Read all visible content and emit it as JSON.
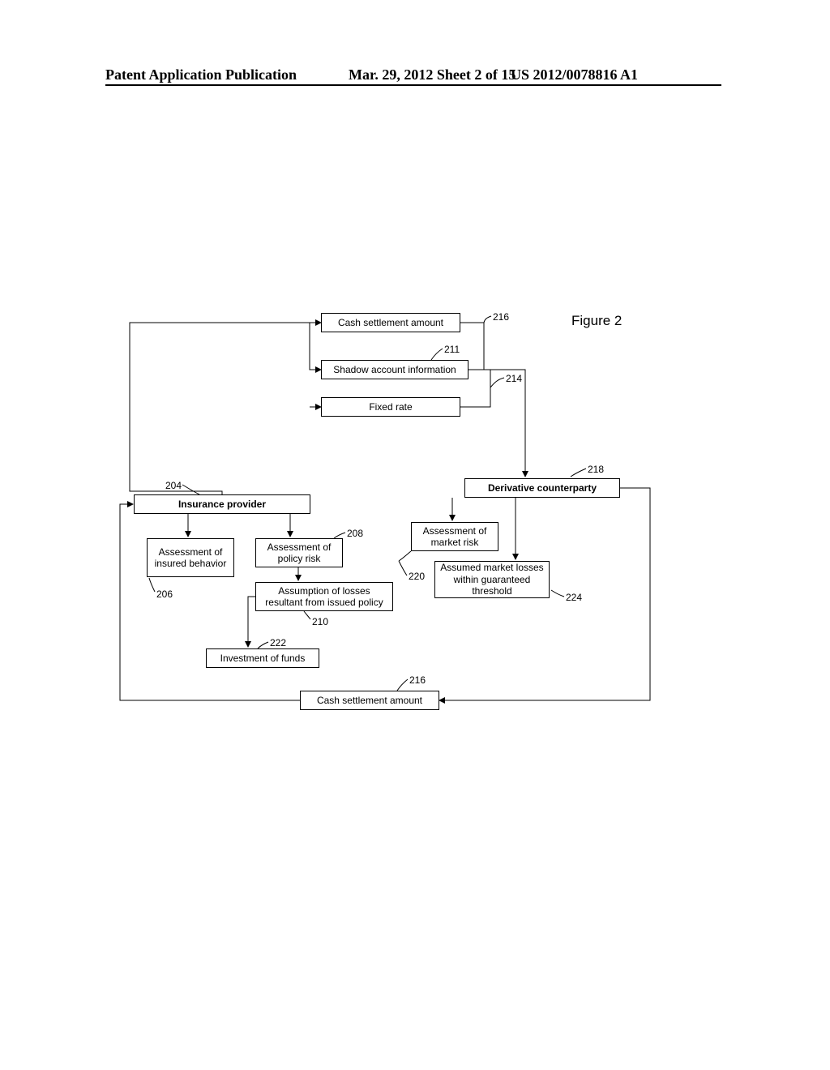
{
  "header": {
    "left": "Patent Application Publication",
    "mid": "Mar. 29, 2012  Sheet 2 of 15",
    "right": "US 2012/0078816 A1"
  },
  "figureLabel": "Figure 2",
  "boxes": {
    "cash_top": "Cash settlement amount",
    "shadow": "Shadow account information",
    "fixed": "Fixed rate",
    "insurance_provider": "Insurance provider",
    "derivative_cp": "Derivative counterparty",
    "assess_behavior": "Assessment of insured behavior",
    "assess_policy": "Assessment of policy risk",
    "assess_market": "Assessment of market risk",
    "assumption_losses": "Assumption of losses resultant from issued policy",
    "assumed_market": "Assumed market losses within guaranteed threshold",
    "investment": "Investment of funds",
    "cash_bottom": "Cash settlement amount"
  },
  "refs": {
    "r204": "204",
    "r206": "206",
    "r208": "208",
    "r210": "210",
    "r211": "211",
    "r214": "214",
    "r216a": "216",
    "r216b": "216",
    "r218": "218",
    "r220": "220",
    "r222": "222",
    "r224": "224"
  }
}
